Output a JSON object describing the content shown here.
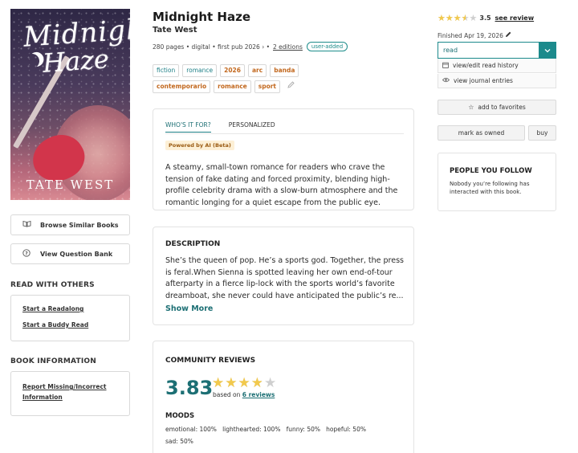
{
  "book": {
    "title": "Midnight Haze",
    "author": "Tate West",
    "cover_title_line1": "Midnight",
    "cover_title_line2": "Haze",
    "cover_author": "TATE WEST",
    "meta_text": "280 pages • digital • first pub 2026 › •",
    "editions_link": "2 editions",
    "user_added_badge": "user-added"
  },
  "tags_row1": [
    {
      "label": "fiction",
      "style": "teal"
    },
    {
      "label": "romance",
      "style": "teal"
    },
    {
      "label": "2026",
      "style": "orange"
    },
    {
      "label": "arc",
      "style": "orange"
    },
    {
      "label": "banda",
      "style": "orange"
    }
  ],
  "tags_row2": [
    {
      "label": "contemporario",
      "style": "orange"
    },
    {
      "label": "romance",
      "style": "orange"
    },
    {
      "label": "sport",
      "style": "orange"
    }
  ],
  "sidebar": {
    "browse_similar": "Browse Similar Books",
    "question_bank": "View Question Bank",
    "read_with_others_heading": "READ WITH OTHERS",
    "start_readalong": "Start a Readalong",
    "start_buddy_read": "Start a Buddy Read",
    "book_info_heading": "BOOK INFORMATION",
    "report_missing_line1": "Report Missing/Incorrect",
    "report_missing_line2": "Information"
  },
  "who_card": {
    "tab_active": "WHO'S IT FOR?",
    "tab_other": "PERSONALIZED",
    "ai_badge": "Powered by AI (Beta)",
    "lines": [
      "A steamy, small-town romance for readers who crave the",
      "tension of fake dating and forced proximity, blending high-",
      "profile celebrity drama with a slow-burn atmosphere and the",
      "romantic longing for a quiet escape from the public eye."
    ]
  },
  "description": {
    "heading": "DESCRIPTION",
    "lines": [
      "She’s the queen of pop. He’s a sports god. Together, the press",
      "is feral.When Sienna is spotted leaving her own end-of-tour",
      "afterparty in a fierce lip-lock with the sports world’s favorite",
      "dreamboat, she never could have anticipated the public’s re..."
    ],
    "show_more": "Show More"
  },
  "community": {
    "heading": "COMMUNITY REVIEWS",
    "average": "3.83",
    "average_value": 3.83,
    "based_on_text": "based on",
    "reviews_link": "6 reviews",
    "moods_heading": "MOODS",
    "moods": [
      {
        "name": "emotional",
        "pct": "100%"
      },
      {
        "name": "lighthearted",
        "pct": "100%"
      },
      {
        "name": "funny",
        "pct": "50%"
      },
      {
        "name": "hopeful",
        "pct": "50%"
      },
      {
        "name": "sad",
        "pct": "50%"
      }
    ]
  },
  "right": {
    "user_rating": "3.5",
    "user_rating_value": 3.5,
    "see_review": "see review",
    "finished": "Finished Apr 19, 2026",
    "status_value": "read",
    "edit_history": "view/edit read history",
    "journal": "view journal entries",
    "favorites": "add to favorites",
    "mark_owned": "mark as owned",
    "buy": "buy",
    "follow_heading": "PEOPLE YOU FOLLOW",
    "follow_text": "Nobody you’re following has interacted with this book."
  },
  "colors": {
    "accent": "#1c8a8c",
    "star": "#f2c94c",
    "tag_orange": "#c2681e",
    "ai_badge_bg": "#fdf0d6"
  },
  "icons": [
    "book-open-icon",
    "question-circle-icon",
    "pencil-icon",
    "chevron-down-icon",
    "calendar-icon",
    "eye-icon",
    "star-icon"
  ]
}
